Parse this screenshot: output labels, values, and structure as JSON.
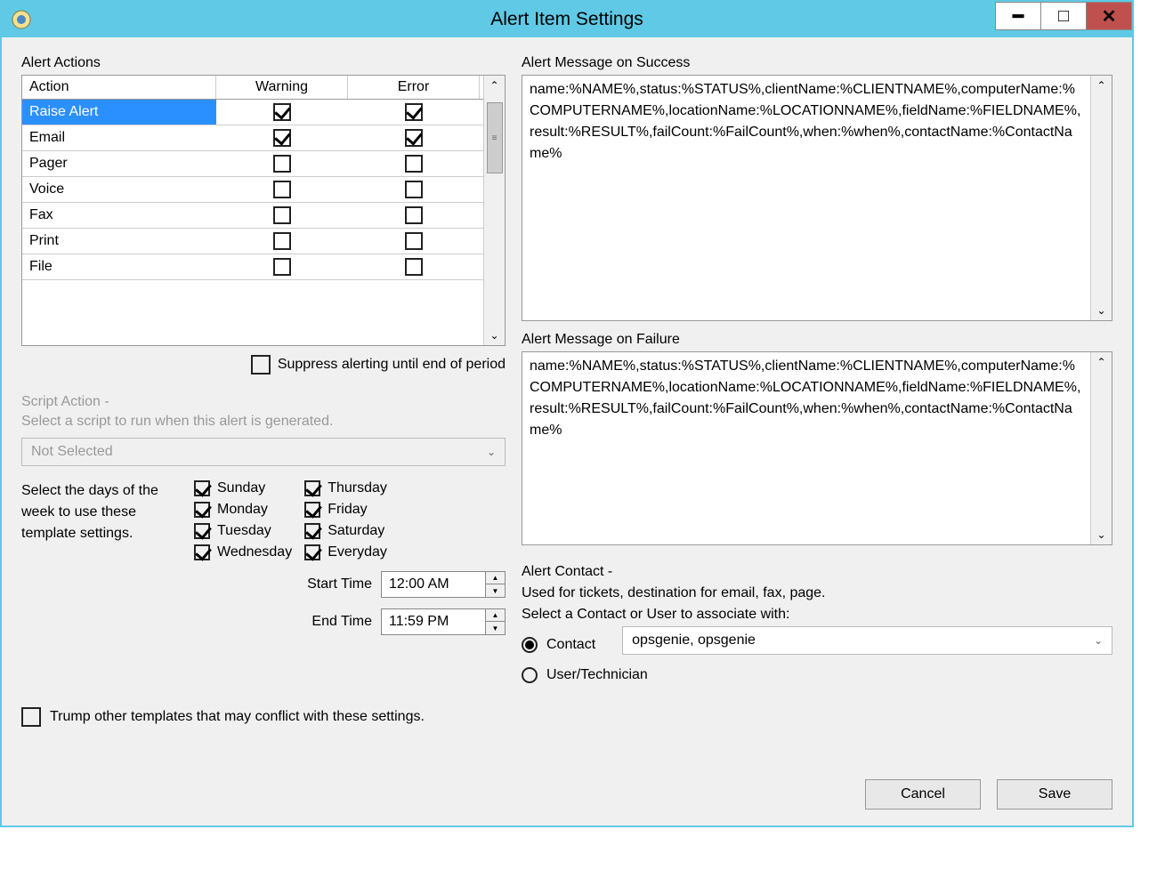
{
  "window": {
    "title": "Alert Item Settings",
    "min_glyph": "━",
    "max_glyph": "□",
    "close_glyph": "✕"
  },
  "alert_actions": {
    "header": "Alert Actions",
    "col_action": "Action",
    "col_warning": "Warning",
    "col_error": "Error",
    "scroll_up": "⌃",
    "scroll_down": "⌄",
    "scroll_grip": "≡",
    "rows": [
      {
        "name": "Raise Alert",
        "warning": true,
        "error": true,
        "selected": true
      },
      {
        "name": "Email",
        "warning": true,
        "error": true,
        "selected": false
      },
      {
        "name": "Pager",
        "warning": false,
        "error": false,
        "selected": false
      },
      {
        "name": "Voice",
        "warning": false,
        "error": false,
        "selected": false
      },
      {
        "name": "Fax",
        "warning": false,
        "error": false,
        "selected": false
      },
      {
        "name": "Print",
        "warning": false,
        "error": false,
        "selected": false
      },
      {
        "name": "File",
        "warning": false,
        "error": false,
        "selected": false
      }
    ]
  },
  "suppress": {
    "label": "Suppress alerting until end of period",
    "checked": false
  },
  "script": {
    "heading": "Script Action -",
    "desc": "Select a script to run when this alert is generated.",
    "value": "Not Selected"
  },
  "days": {
    "label": "Select the days of the week to use these template settings.",
    "col1": [
      {
        "label": "Sunday",
        "checked": true
      },
      {
        "label": "Monday",
        "checked": true
      },
      {
        "label": "Tuesday",
        "checked": true
      },
      {
        "label": "Wednesday",
        "checked": true
      }
    ],
    "col2": [
      {
        "label": "Thursday",
        "checked": true
      },
      {
        "label": "Friday",
        "checked": true
      },
      {
        "label": "Saturday",
        "checked": true
      },
      {
        "label": "Everyday",
        "checked": true
      }
    ]
  },
  "times": {
    "start_label": "Start Time",
    "start_value": "12:00 AM",
    "end_label": "End Time",
    "end_value": "11:59 PM"
  },
  "success": {
    "header": "Alert Message on Success",
    "text": "name:%NAME%,status:%STATUS%,clientName:%CLIENTNAME%,computerName:%COMPUTERNAME%,locationName:%LOCATIONNAME%,fieldName:%FIELDNAME%,result:%RESULT%,failCount:%FailCount%,when:%when%,contactName:%ContactName%"
  },
  "failure": {
    "header": "Alert Message on Failure",
    "text": "name:%NAME%,status:%STATUS%,clientName:%CLIENTNAME%,computerName:%COMPUTERNAME%,locationName:%LOCATIONNAME%,fieldName:%FIELDNAME%,result:%RESULT%,failCount:%FailCount%,when:%when%,contactName:%ContactName%"
  },
  "contact": {
    "heading": "Alert Contact -",
    "desc1": "Used for tickets, destination for email, fax, page.",
    "desc2": "Select a Contact or User to associate with:",
    "opt_contact": "Contact",
    "opt_user": "User/Technician",
    "selected": "contact",
    "contact_value": "opsgenie, opsgenie"
  },
  "trump": {
    "label": "Trump other templates that may conflict with these settings.",
    "checked": false
  },
  "buttons": {
    "cancel": "Cancel",
    "save": "Save"
  }
}
